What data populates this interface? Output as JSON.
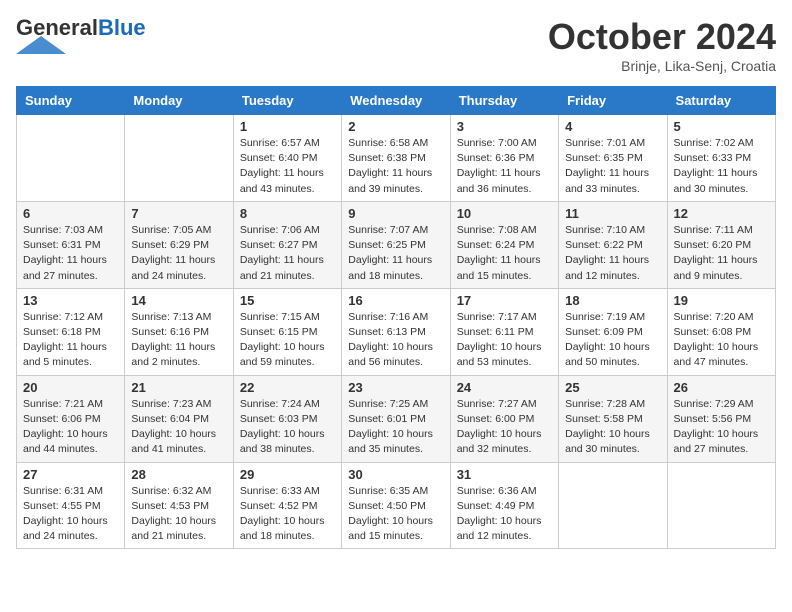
{
  "header": {
    "logo_general": "General",
    "logo_blue": "Blue",
    "month_title": "October 2024",
    "location": "Brinje, Lika-Senj, Croatia"
  },
  "days_of_week": [
    "Sunday",
    "Monday",
    "Tuesday",
    "Wednesday",
    "Thursday",
    "Friday",
    "Saturday"
  ],
  "weeks": [
    [
      {
        "day": "",
        "info": ""
      },
      {
        "day": "",
        "info": ""
      },
      {
        "day": "1",
        "info": "Sunrise: 6:57 AM\nSunset: 6:40 PM\nDaylight: 11 hours and 43 minutes."
      },
      {
        "day": "2",
        "info": "Sunrise: 6:58 AM\nSunset: 6:38 PM\nDaylight: 11 hours and 39 minutes."
      },
      {
        "day": "3",
        "info": "Sunrise: 7:00 AM\nSunset: 6:36 PM\nDaylight: 11 hours and 36 minutes."
      },
      {
        "day": "4",
        "info": "Sunrise: 7:01 AM\nSunset: 6:35 PM\nDaylight: 11 hours and 33 minutes."
      },
      {
        "day": "5",
        "info": "Sunrise: 7:02 AM\nSunset: 6:33 PM\nDaylight: 11 hours and 30 minutes."
      }
    ],
    [
      {
        "day": "6",
        "info": "Sunrise: 7:03 AM\nSunset: 6:31 PM\nDaylight: 11 hours and 27 minutes."
      },
      {
        "day": "7",
        "info": "Sunrise: 7:05 AM\nSunset: 6:29 PM\nDaylight: 11 hours and 24 minutes."
      },
      {
        "day": "8",
        "info": "Sunrise: 7:06 AM\nSunset: 6:27 PM\nDaylight: 11 hours and 21 minutes."
      },
      {
        "day": "9",
        "info": "Sunrise: 7:07 AM\nSunset: 6:25 PM\nDaylight: 11 hours and 18 minutes."
      },
      {
        "day": "10",
        "info": "Sunrise: 7:08 AM\nSunset: 6:24 PM\nDaylight: 11 hours and 15 minutes."
      },
      {
        "day": "11",
        "info": "Sunrise: 7:10 AM\nSunset: 6:22 PM\nDaylight: 11 hours and 12 minutes."
      },
      {
        "day": "12",
        "info": "Sunrise: 7:11 AM\nSunset: 6:20 PM\nDaylight: 11 hours and 9 minutes."
      }
    ],
    [
      {
        "day": "13",
        "info": "Sunrise: 7:12 AM\nSunset: 6:18 PM\nDaylight: 11 hours and 5 minutes."
      },
      {
        "day": "14",
        "info": "Sunrise: 7:13 AM\nSunset: 6:16 PM\nDaylight: 11 hours and 2 minutes."
      },
      {
        "day": "15",
        "info": "Sunrise: 7:15 AM\nSunset: 6:15 PM\nDaylight: 10 hours and 59 minutes."
      },
      {
        "day": "16",
        "info": "Sunrise: 7:16 AM\nSunset: 6:13 PM\nDaylight: 10 hours and 56 minutes."
      },
      {
        "day": "17",
        "info": "Sunrise: 7:17 AM\nSunset: 6:11 PM\nDaylight: 10 hours and 53 minutes."
      },
      {
        "day": "18",
        "info": "Sunrise: 7:19 AM\nSunset: 6:09 PM\nDaylight: 10 hours and 50 minutes."
      },
      {
        "day": "19",
        "info": "Sunrise: 7:20 AM\nSunset: 6:08 PM\nDaylight: 10 hours and 47 minutes."
      }
    ],
    [
      {
        "day": "20",
        "info": "Sunrise: 7:21 AM\nSunset: 6:06 PM\nDaylight: 10 hours and 44 minutes."
      },
      {
        "day": "21",
        "info": "Sunrise: 7:23 AM\nSunset: 6:04 PM\nDaylight: 10 hours and 41 minutes."
      },
      {
        "day": "22",
        "info": "Sunrise: 7:24 AM\nSunset: 6:03 PM\nDaylight: 10 hours and 38 minutes."
      },
      {
        "day": "23",
        "info": "Sunrise: 7:25 AM\nSunset: 6:01 PM\nDaylight: 10 hours and 35 minutes."
      },
      {
        "day": "24",
        "info": "Sunrise: 7:27 AM\nSunset: 6:00 PM\nDaylight: 10 hours and 32 minutes."
      },
      {
        "day": "25",
        "info": "Sunrise: 7:28 AM\nSunset: 5:58 PM\nDaylight: 10 hours and 30 minutes."
      },
      {
        "day": "26",
        "info": "Sunrise: 7:29 AM\nSunset: 5:56 PM\nDaylight: 10 hours and 27 minutes."
      }
    ],
    [
      {
        "day": "27",
        "info": "Sunrise: 6:31 AM\nSunset: 4:55 PM\nDaylight: 10 hours and 24 minutes."
      },
      {
        "day": "28",
        "info": "Sunrise: 6:32 AM\nSunset: 4:53 PM\nDaylight: 10 hours and 21 minutes."
      },
      {
        "day": "29",
        "info": "Sunrise: 6:33 AM\nSunset: 4:52 PM\nDaylight: 10 hours and 18 minutes."
      },
      {
        "day": "30",
        "info": "Sunrise: 6:35 AM\nSunset: 4:50 PM\nDaylight: 10 hours and 15 minutes."
      },
      {
        "day": "31",
        "info": "Sunrise: 6:36 AM\nSunset: 4:49 PM\nDaylight: 10 hours and 12 minutes."
      },
      {
        "day": "",
        "info": ""
      },
      {
        "day": "",
        "info": ""
      }
    ]
  ]
}
